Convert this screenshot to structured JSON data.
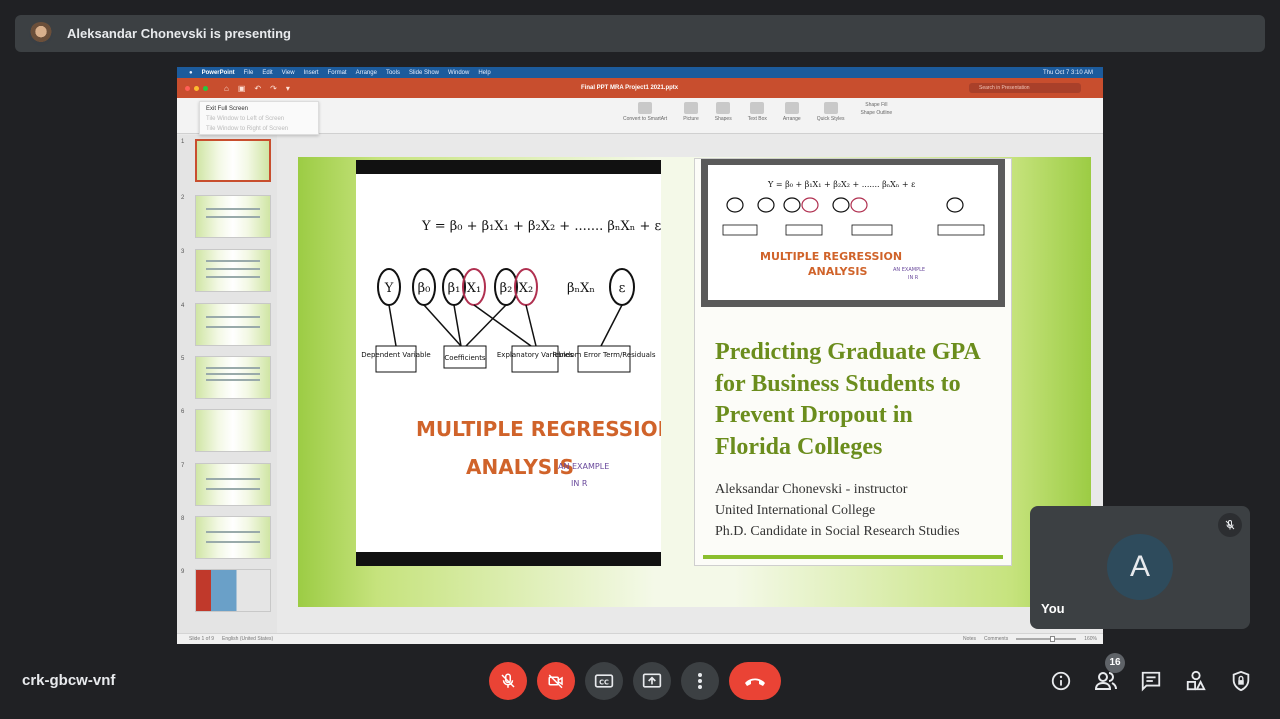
{
  "banner": {
    "presenting_text": "Aleksandar Chonevski is presenting"
  },
  "mac_menubar": {
    "app": "PowerPoint",
    "menus": [
      "File",
      "Edit",
      "View",
      "Insert",
      "Format",
      "Arrange",
      "Tools",
      "Slide Show",
      "Window",
      "Help"
    ],
    "clock": "Thu Oct 7  3:10 AM"
  },
  "powerpoint": {
    "document_title": "Final PPT MRA Project1 2021.pptx",
    "search_placeholder": "Search in Presentation",
    "ribbon_menu": [
      "Exit Full Screen",
      "Tile Window to Left of Screen",
      "Tile Window to Right of Screen"
    ],
    "ribbon_tools": [
      "Convert to SmartArt",
      "Picture",
      "Shapes",
      "Text Box",
      "Arrange",
      "Quick Styles",
      "Shape Fill",
      "Shape Outline"
    ],
    "slide_numbers": [
      "1",
      "2",
      "3",
      "4",
      "5",
      "6",
      "7",
      "8",
      "9"
    ],
    "status_left": "Slide 1 of 9",
    "status_lang": "English (United States)",
    "status_notes": "Notes",
    "status_comments": "Comments",
    "zoom": "160%"
  },
  "slide": {
    "equation": "Y = β₀ + β₁X₁ + β₂X₂ + ....... βₙXₙ + ε",
    "diagram_terms": [
      "Y",
      "β₀",
      "β₁",
      "X₁",
      "β₂",
      "X₂",
      "βₙXₙ",
      "ε"
    ],
    "diagram_labels": [
      "Dependent Variable",
      "Coefficients",
      "Explanatory Variables",
      "Random Error Term/Residuals"
    ],
    "mra_line1": "MULTIPLE REGRESSION",
    "mra_line2": "ANALYSIS",
    "mra_note1": "AN EXAMPLE",
    "mra_note2": "IN R",
    "title_lines": [
      "Predicting Graduate GPA",
      "for Business Students to",
      "Prevent Dropout in",
      "Florida Colleges"
    ],
    "subtitle_lines": [
      "Aleksandar Chonevski - instructor",
      "United International College",
      "Ph.D. Candidate in Social Research Studies"
    ]
  },
  "self_tile": {
    "initial": "A",
    "name": "You"
  },
  "meeting": {
    "code": "crk-gbcw-vnf",
    "participants_count": "16"
  },
  "colors": {
    "end_call": "#ea4335",
    "slide_title": "#6b8d1d",
    "ppt_accent": "#c84e2e"
  },
  "icons": [
    "mic-off-icon",
    "camera-off-icon",
    "captions-icon",
    "present-icon",
    "more-options-icon",
    "end-call-icon",
    "info-icon",
    "people-icon",
    "chat-icon",
    "activities-icon",
    "host-controls-icon"
  ]
}
